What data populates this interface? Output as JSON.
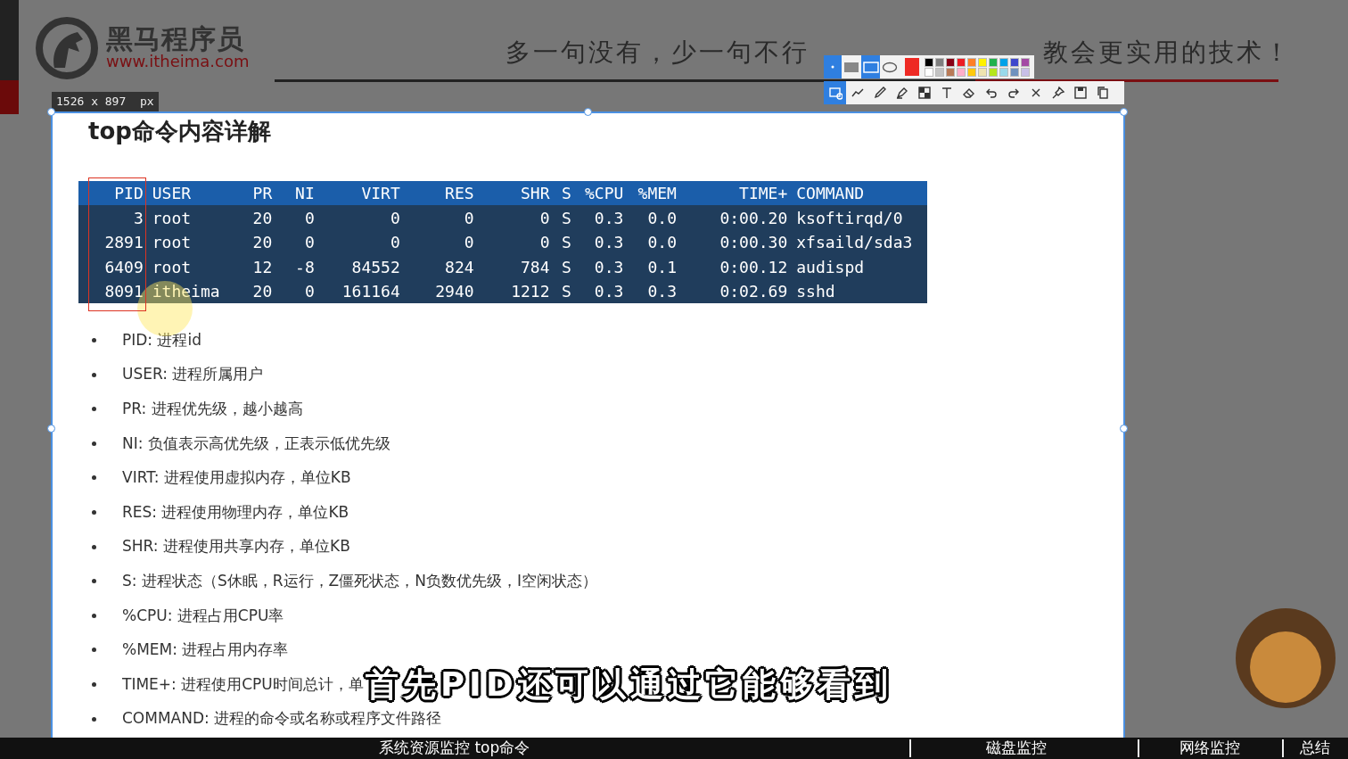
{
  "header": {
    "logo_name": "黑马程序员",
    "logo_url": "www.itheima.com",
    "slogan_parts": [
      "多一句没有，少一句不行",
      "教会更实用的技术！"
    ]
  },
  "capture": {
    "size_label": "1526 x 897  px",
    "shape_tools": [
      {
        "kind": "filled-rect",
        "selected": false
      },
      {
        "kind": "rect",
        "selected": true
      },
      {
        "kind": "ellipse",
        "selected": false
      }
    ],
    "active_colors": [
      {
        "color": "#ee2a24"
      }
    ],
    "swatches": [
      {
        "color": "#000000"
      },
      {
        "color": "#7f7f7f"
      },
      {
        "color": "#880015"
      },
      {
        "color": "#ed1c24"
      },
      {
        "color": "#ff7f27"
      },
      {
        "color": "#fff200"
      },
      {
        "color": "#22b14c"
      },
      {
        "color": "#00a2e8"
      },
      {
        "color": "#3f48cc"
      },
      {
        "color": "#a349a4"
      },
      {
        "color": "#ffffff"
      },
      {
        "color": "#c3c3c3"
      },
      {
        "color": "#b97a57"
      },
      {
        "color": "#ffaec9"
      },
      {
        "color": "#ffc90e"
      },
      {
        "color": "#efe4b0"
      },
      {
        "color": "#b5e61d"
      },
      {
        "color": "#99d9ea"
      },
      {
        "color": "#7092be"
      },
      {
        "color": "#c8bfe7"
      }
    ],
    "tools": [
      {
        "kind": "select",
        "selected": true
      },
      {
        "kind": "line",
        "selected": false
      },
      {
        "kind": "pen",
        "selected": false
      },
      {
        "kind": "marker",
        "selected": false
      },
      {
        "kind": "mosaic",
        "selected": false
      },
      {
        "kind": "text",
        "selected": false
      },
      {
        "kind": "eraser",
        "selected": false
      },
      {
        "kind": "undo",
        "selected": false
      },
      {
        "kind": "redo",
        "selected": false
      },
      {
        "kind": "close",
        "selected": false
      },
      {
        "kind": "pin",
        "selected": false
      },
      {
        "kind": "save",
        "selected": false
      },
      {
        "kind": "copy",
        "selected": false
      }
    ]
  },
  "slide": {
    "title": "top命令内容详解",
    "table": {
      "columns": [
        "PID",
        "USER",
        "PR",
        "NI",
        "VIRT",
        "RES",
        "SHR",
        "S",
        "%CPU",
        "%MEM",
        "TIME+",
        "COMMAND"
      ],
      "rows": [
        [
          "3",
          "root",
          "20",
          "0",
          "0",
          "0",
          "0",
          "S",
          "0.3",
          "0.0",
          "0:00.20",
          "ksoftirqd/0"
        ],
        [
          "2891",
          "root",
          "20",
          "0",
          "0",
          "0",
          "0",
          "S",
          "0.3",
          "0.0",
          "0:00.30",
          "xfsaild/sda3"
        ],
        [
          "6409",
          "root",
          "12",
          "-8",
          "84552",
          "824",
          "784",
          "S",
          "0.3",
          "0.1",
          "0:00.12",
          "audispd"
        ],
        [
          "8091",
          "itheima",
          "20",
          "0",
          "161164",
          "2940",
          "1212",
          "S",
          "0.3",
          "0.3",
          "0:02.69",
          "sshd"
        ]
      ]
    },
    "bullets": [
      "PID: 进程id",
      "USER: 进程所属用户",
      "PR: 进程优先级，越小越高",
      "NI: 负值表示高优先级，正表示低优先级",
      "VIRT: 进程使用虚拟内存，单位KB",
      "RES: 进程使用物理内存，单位KB",
      "SHR: 进程使用共享内存，单位KB",
      "S: 进程状态（S休眠，R运行，Z僵死状态，N负数优先级，I空闲状态）",
      "%CPU: 进程占用CPU率",
      "%MEM: 进程占用内存率",
      "TIME+: 进程使用CPU时间总计，单",
      "COMMAND: 进程的命令或名称或程序文件路径"
    ]
  },
  "subtitle": "首先PID还可以通过它能够看到",
  "chapters": [
    "系统资源监控 top命令",
    "磁盘监控",
    "网络监控",
    "总结"
  ]
}
